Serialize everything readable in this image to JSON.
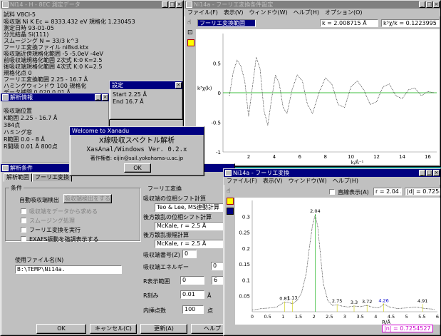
{
  "mainwin": {
    "title": "NI14 - H - 8EC 測定データ",
    "rows": [
      "試料 V8CI-5",
      "吸収端  Ni K     Ec = 8333.432 eV   規格化  1.230453",
      "測定日時   93-01-05",
      "分光結晶  Si(111)",
      "スムージング   N = 33/3        k^3",
      "フーリエ変換ファイル  ni8sd.ktx",
      "吸収端近傍規格化範囲  -5  -5.0eV  -4eV",
      "前吸収端規格化範囲  2次式  K:0  K=2.5",
      "後吸収端規格化範囲  4次式  K:0  K=2.5",
      "         規格化点 0",
      "フーリエ変換範囲  2.25 - 16.7 Å",
      "ハミングウィンドウ  100  規格化",
      "データ補間  0.020   0.01 Å"
    ]
  },
  "kaiseki_info": {
    "title": "解析情報",
    "rows": [
      "吸収端位置",
      "K範囲  2.25 - 16.7 Å",
      "          384点",
      "ハミング窓",
      "R範囲  0.0 - 8 Å",
      "R間隔  0.01 Å 800点"
    ]
  },
  "settings": {
    "title": "設定",
    "start": "Start  2.25 Å",
    "end": "End  16.7 Å"
  },
  "fourier": {
    "title": "Ni14a - フーリエ変換条件設定",
    "menu": [
      "ファイル(F)",
      "表示(V)",
      "ウィンドウ(W)",
      "ヘルプ(H)",
      "オプション(O)"
    ],
    "label_field": "フーリエ変換範囲",
    "cursor_x": "k = 2.008715 Å",
    "cursor_y": "k³χ/k = 0.1223995",
    "ylabel": "k³χ(k)",
    "xlabel": "k/Å⁻¹"
  },
  "chart_data": [
    {
      "type": "line",
      "title": "",
      "xlabel": "k/Å⁻¹",
      "ylabel": "k³χ(k)",
      "xlim": [
        0,
        16.7
      ],
      "ylim": [
        -1,
        1
      ],
      "x_ticks": [
        "2",
        "4",
        "6",
        "8",
        "10",
        "12",
        "14",
        "16"
      ],
      "y_ticks": [
        "0.5",
        "0",
        "-0.5",
        "-1"
      ],
      "series": [
        {
          "x": [
            0.5,
            0.8,
            1.1,
            1.4,
            1.7,
            2.0,
            2.3,
            2.6,
            2.9,
            3.2,
            3.5,
            3.8,
            4.1,
            4.4,
            4.7,
            5.0,
            5.4,
            5.8,
            6.2,
            6.6,
            7.0,
            7.5,
            8.0,
            8.5,
            9.0,
            9.5,
            10.0,
            10.5,
            11.0,
            11.5,
            12.0,
            12.5,
            13.0,
            13.5,
            14.0,
            14.5,
            15.0,
            15.5,
            16.0,
            16.5
          ],
          "y": [
            -0.05,
            0.35,
            0.55,
            0.45,
            0.2,
            -0.4,
            0.1,
            0.6,
            0.4,
            -0.3,
            -0.55,
            -0.1,
            0.3,
            0.15,
            -0.25,
            -0.35,
            0.05,
            0.3,
            0.2,
            -0.2,
            -0.35,
            0.0,
            0.25,
            0.15,
            -0.2,
            -0.25,
            0.1,
            0.2,
            0.05,
            -0.2,
            -0.15,
            0.1,
            0.15,
            -0.05,
            -0.1,
            0.05,
            0.08,
            -0.05,
            0.02,
            0.0
          ]
        }
      ]
    },
    {
      "type": "line",
      "title": "",
      "xlabel": "R/Å",
      "ylabel": "",
      "xlim": [
        0,
        6
      ],
      "ylim": [
        0,
        0.35
      ],
      "x_ticks": [
        "0",
        "0.5",
        "1",
        "1.5",
        "2",
        "2.5",
        "3",
        "3.5",
        "4",
        "4.5",
        "5",
        "5.5",
        "6"
      ],
      "y_ticks": [
        "0.3",
        "0.25",
        "0.2",
        "0.15",
        "0.1",
        "0.05"
      ],
      "peak_labels": [
        {
          "x": 1.05,
          "y": 0.03,
          "text": "0.81"
        },
        {
          "x": 1.3,
          "y": 0.033,
          "text": "1.13"
        },
        {
          "x": 2.04,
          "y": 0.305,
          "text": "2.04"
        },
        {
          "x": 2.75,
          "y": 0.022,
          "text": "2.75"
        },
        {
          "x": 3.3,
          "y": 0.018,
          "text": "3.3"
        },
        {
          "x": 3.72,
          "y": 0.02,
          "text": "3.72"
        },
        {
          "x": 4.26,
          "y": 0.024,
          "text": "4.26"
        },
        {
          "x": 5.52,
          "y": 0.022,
          "text": "4.91"
        }
      ],
      "series": [
        {
          "x": [
            0.0,
            0.3,
            0.6,
            0.8,
            1.0,
            1.15,
            1.3,
            1.45,
            1.6,
            1.75,
            1.85,
            1.95,
            2.04,
            2.12,
            2.2,
            2.3,
            2.45,
            2.6,
            2.75,
            2.9,
            3.1,
            3.3,
            3.5,
            3.72,
            3.9,
            4.1,
            4.26,
            4.45,
            4.7,
            5.0,
            5.3,
            5.6,
            5.9
          ],
          "y": [
            0.005,
            0.01,
            0.012,
            0.015,
            0.028,
            0.03,
            0.025,
            0.035,
            0.06,
            0.12,
            0.2,
            0.27,
            0.305,
            0.27,
            0.19,
            0.09,
            0.035,
            0.02,
            0.022,
            0.018,
            0.015,
            0.018,
            0.016,
            0.02,
            0.014,
            0.012,
            0.024,
            0.015,
            0.01,
            0.012,
            0.015,
            0.01,
            0.008
          ]
        }
      ]
    }
  ],
  "fourier2": {
    "title": "Ni14a - フーリエ変換",
    "menu": [
      "ファイル(F)",
      "表示(V)",
      "ウィンドウ(W)",
      "ヘルプ(H)"
    ],
    "checkbox": "直線表示(A)",
    "cursor_x": "r = 2.04 Å",
    "cursor_y": "|d| = 0.7254527",
    "footer": "|n| = 0.7254527"
  },
  "dialog": {
    "title": "解析条件",
    "tabs": [
      "解析範囲",
      "フーリエ変換"
    ],
    "tab_fourier": "フーリエ変換",
    "group_left": "条件",
    "auto_detect": "自動吸収端検出",
    "auto_detect_btn": "吸収端検出をする",
    "cb1": "吸収端をデータから求める",
    "cb2": "スムージング処理",
    "cb3": "フーリエ変換を実行",
    "cb4": "EXAFS振動を強調表示する",
    "file_label": "使用ファイル名(N)",
    "file_value": "B:\\TEMP\\Ni14a.",
    "lbl1": "吸収端の位相シフト計算",
    "val1": "Teo & Lee, MS連動計算",
    "lbl2": "後方散乱の位相シフト計算",
    "val2": "McKale, r = 2.5 Å",
    "lbl3": "後方散乱振幅計算",
    "val3": "McKale, r = 2.5 Å",
    "lbl4": "吸収端番号(Z)",
    "val4": "0",
    "lbl5": "吸収端エネルギー",
    "val5": "0",
    "lbl6": "R表示範囲",
    "val6a": "0",
    "val6b": "6",
    "lbl7": "R刻み",
    "val7": "0.01",
    "unit7": "Å",
    "lbl8": "内挿点数",
    "val8": "100",
    "unit8": "点",
    "ok": "OK",
    "cancel": "キャンセル(C)",
    "apply": "更新(A)",
    "help": "ヘルプ"
  },
  "splash": {
    "title": "Welcome to Xanadu",
    "line1": "X線吸収スペクトル解析",
    "line2": "XasAnal/Windows Ver. 0.2.x",
    "line3": "著作権者: eijin@sail.yokohama-u.ac.jp",
    "ok": "OK"
  }
}
